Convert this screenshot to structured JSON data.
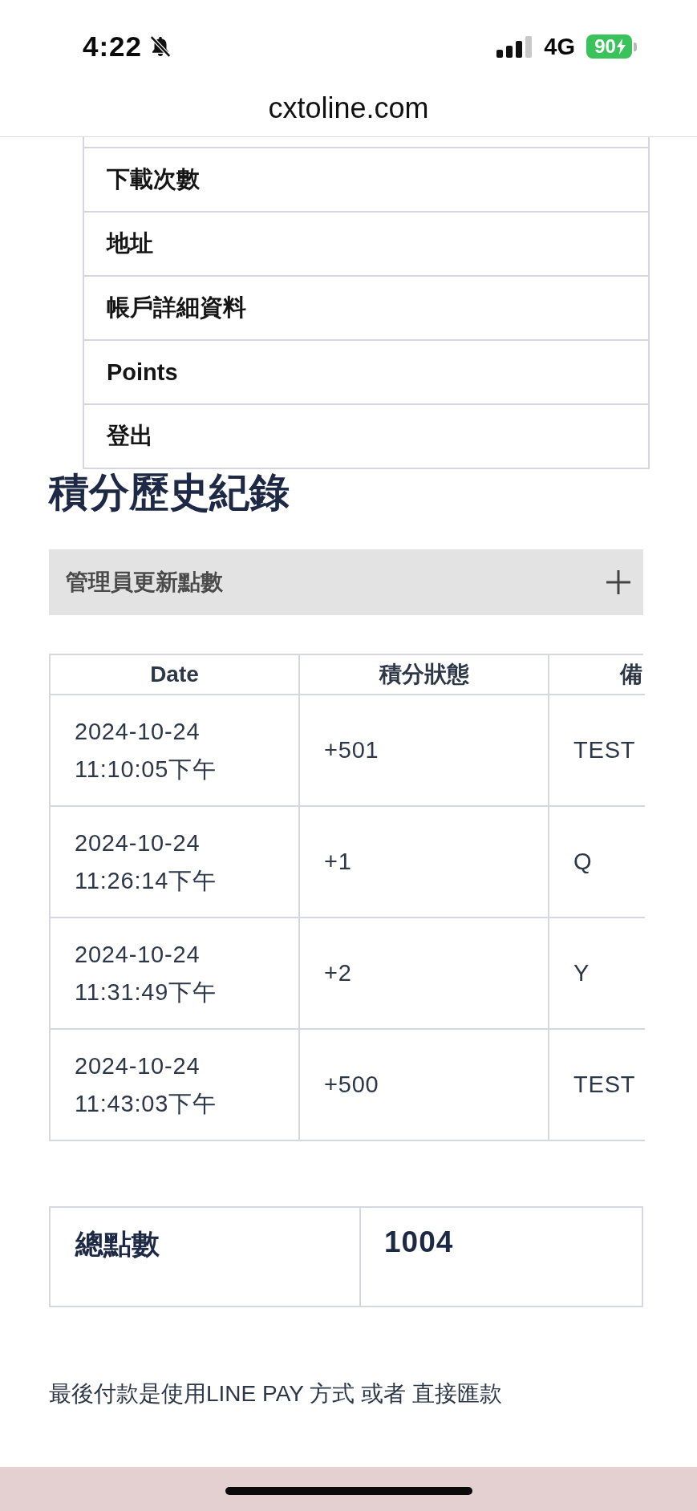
{
  "status_bar": {
    "time": "4:22",
    "network": "4G",
    "battery": "90"
  },
  "address_bar": {
    "url": "cxtoline.com"
  },
  "account_menu": {
    "items": [
      {
        "label": "下載次數"
      },
      {
        "label": "地址"
      },
      {
        "label": "帳戶詳細資料"
      },
      {
        "label": "Points"
      },
      {
        "label": "登出"
      }
    ]
  },
  "page_title": "積分歷史紀錄",
  "accordion": {
    "label": "管理員更新點數",
    "expanded": false
  },
  "points_table": {
    "columns": [
      "Date",
      "積分狀態",
      "備"
    ],
    "rows": [
      [
        "2024-10-24 11:10:05下午",
        "+501",
        "TEST"
      ],
      [
        "2024-10-24 11:26:14下午",
        "+1",
        "Q"
      ],
      [
        "2024-10-24 11:31:49下午",
        "+2",
        "Y"
      ],
      [
        "2024-10-24 11:43:03下午",
        "+500",
        "TEST"
      ]
    ]
  },
  "total": {
    "label": "總點數",
    "value": "1004"
  },
  "payment_note": "最後付款是使用LINE PAY 方式 或者 直接匯款"
}
